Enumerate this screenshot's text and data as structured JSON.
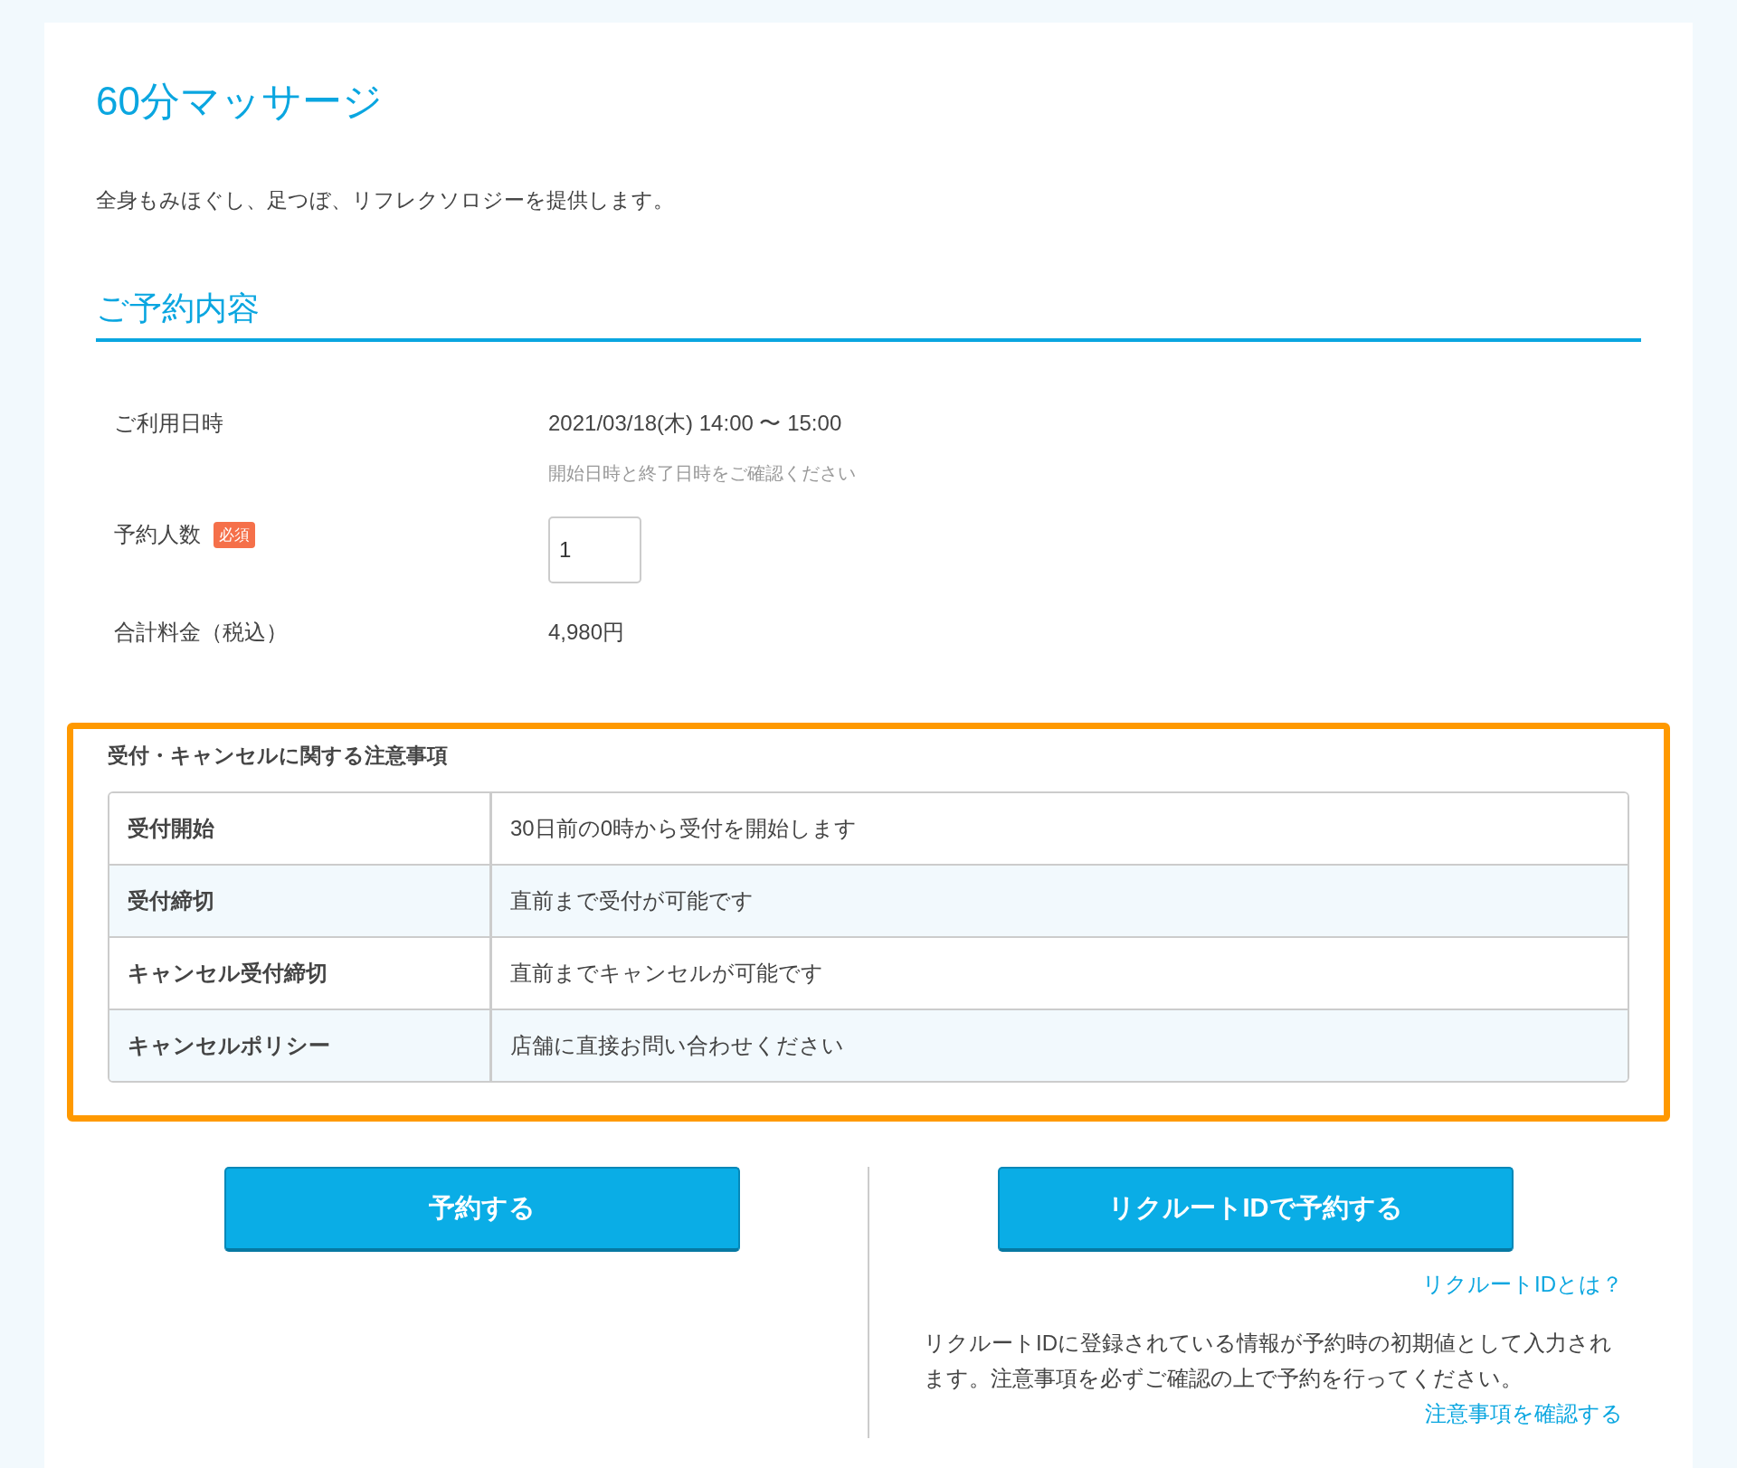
{
  "title": "60分マッサージ",
  "description": "全身もみほぐし、足つぼ、リフレクソロジーを提供します。",
  "section_heading": "ご予約内容",
  "fields": [
    {
      "kind": "text",
      "label": "ご利用日時",
      "value": "2021/03/18(木) 14:00 〜 15:00",
      "hint": "開始日時と終了日時をご確認ください"
    },
    {
      "kind": "input",
      "label": "予約人数",
      "badge": "必須",
      "value": "1"
    },
    {
      "kind": "text",
      "label": "合計料金（税込）",
      "value": "4,980円"
    }
  ],
  "notice": {
    "title": "受付・キャンセルに関する注意事項",
    "rows": [
      {
        "label": "受付開始",
        "value": "30日前の0時から受付を開始します"
      },
      {
        "label": "受付締切",
        "value": "直前まで受付が可能です"
      },
      {
        "label": "キャンセル受付締切",
        "value": "直前までキャンセルが可能です"
      },
      {
        "label": "キャンセルポリシー",
        "value": "店舗に直接お問い合わせください"
      }
    ]
  },
  "reserve_button": "予約する",
  "recruit_button": "リクルートIDで予約する",
  "recruit_link": "リクルートIDとは？",
  "recruit_note": "リクルートIDに登録されている情報が予約時の初期値として入力されます。注意事項を必ずご確認の上で予約を行ってください。",
  "notice_link": "注意事項を確認する"
}
